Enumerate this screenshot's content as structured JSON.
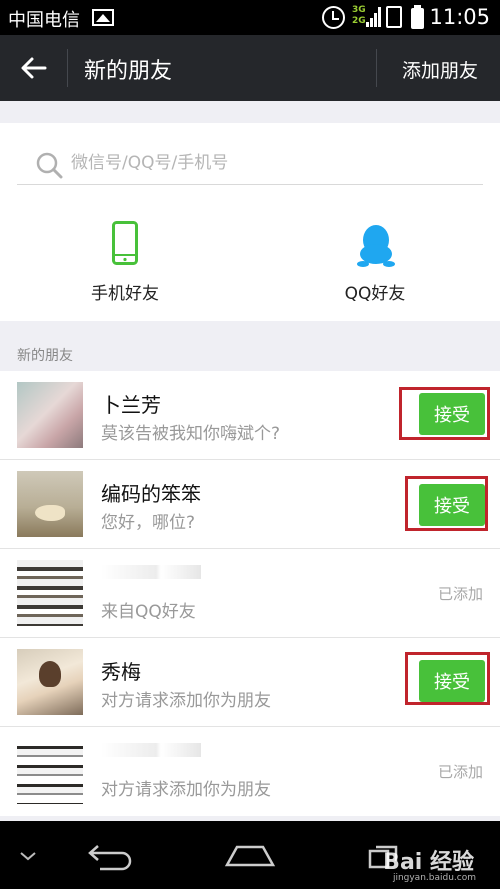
{
  "status_bar": {
    "carrier": "中国电信",
    "network": [
      "3G",
      "2G"
    ],
    "time": "11:05"
  },
  "header": {
    "title": "新的朋友",
    "action_label": "添加朋友"
  },
  "search": {
    "placeholder": "微信号/QQ号/手机号"
  },
  "entries": [
    {
      "label": "手机好友",
      "icon": "phone-icon"
    },
    {
      "label": "QQ好友",
      "icon": "qq-icon"
    }
  ],
  "section_title": "新的朋友",
  "friends": [
    {
      "name": "卜兰芳",
      "message": "莫该告被我知你嗨斌个?",
      "action": "接受"
    },
    {
      "name": "编码的笨笨",
      "message": "您好，哪位?",
      "action": "接受"
    },
    {
      "name": "",
      "message": "来自QQ好友",
      "status": "已添加"
    },
    {
      "name": "秀梅",
      "message": "对方请求添加你为朋友",
      "action": "接受"
    },
    {
      "name": "",
      "message": "对方请求添加你为朋友",
      "status": "已添加"
    }
  ],
  "watermark": {
    "brand": "Bai 经验",
    "url": "jingyan.baidu.com"
  },
  "colors": {
    "accept_green": "#48c13a",
    "highlight_red": "#c0242c",
    "header_bg": "#25272b"
  }
}
